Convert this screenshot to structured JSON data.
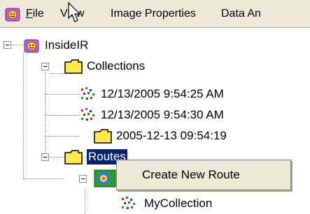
{
  "menubar": {
    "file_label_acc": "F",
    "file_label_rest": "ile",
    "view_label": "View",
    "image_properties_label": "Image Properties",
    "data_label": "Data An"
  },
  "tree": {
    "root_label": "InsideIR",
    "collections_label": "Collections",
    "collection_items": [
      "12/13/2005 9:54:25 AM",
      "12/13/2005 9:54:30 AM"
    ],
    "folder_item_label": "2005-12-13 09:54:19",
    "routes_label": "Routes",
    "route_child_label": "MyCollection"
  },
  "context_menu": {
    "create_new_route_label": "Create New Route"
  },
  "colors": {
    "menubar_bg": "#ece9d8",
    "selection_bg": "#0a246a",
    "folder_yellow": "#ffe94d"
  }
}
